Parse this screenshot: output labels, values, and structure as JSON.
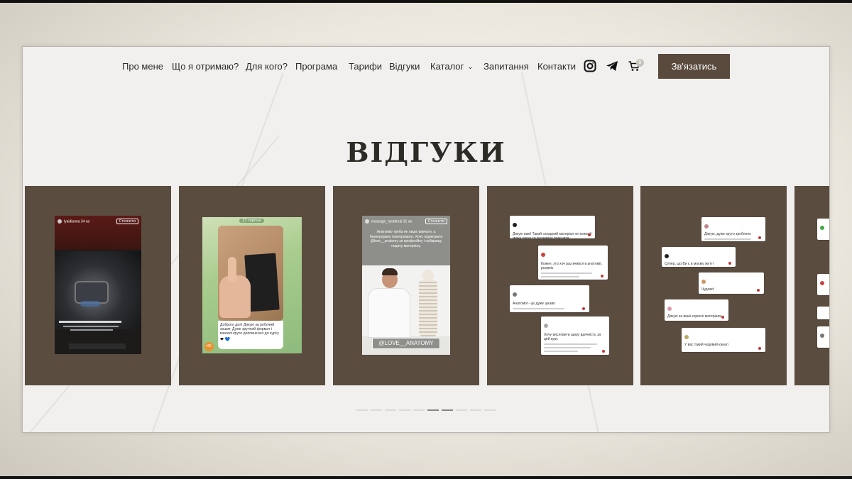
{
  "nav": {
    "items": [
      "Про мене",
      "Що я отримаю?",
      "Для кого?",
      "Програма",
      "Тарифи",
      "Відгуки",
      "Каталог",
      "Запитання",
      "Контакти"
    ],
    "cart_count": "0",
    "cta_label": "Зв'язатись"
  },
  "section_title": "ВІДГУКИ",
  "cards": [
    {
      "type": "story",
      "username": "lyaidianna",
      "time": "34 хв",
      "button": "Стежити"
    },
    {
      "type": "chat",
      "date": "23 серпня",
      "message": "Доброго дня! Дякую за робочий зошит. Дуже зручний формат і взагалі круте доповнення до курсу",
      "avatar_label": "КК"
    },
    {
      "type": "story",
      "username": "massage_nyuttireal",
      "time": "31 хв",
      "button": "Стежити",
      "caption": "Анатомію треба не лише вивчати, а безперервно повторювати. Хочу подякувати @love__anatomy за професійну і найкращу подачу матеріалу.",
      "tag": "@LOVE__ANATOMY"
    },
    {
      "type": "comments",
      "comments": [
        {
          "text": "Дякую вам! Такий складний матеріал не кожний може легко та зрозуміло пояснити"
        },
        {
          "text": "Кожен, хто хоч раз вчився в анатомії, розуміє"
        },
        {
          "text": "Анатомія - це дуже цікаво"
        },
        {
          "text": "Хочу висловити щиру вдячність за цей курс"
        }
      ]
    },
    {
      "type": "comments",
      "comments": [
        {
          "text": "Дякую, дуже круто зроблено"
        },
        {
          "text": "Супер, що Ви є в моєму житті"
        },
        {
          "text": "Чудово!"
        },
        {
          "text": "Дякую за ваші корисні матеріали"
        },
        {
          "text": "У вас такий чудовий канал"
        }
      ]
    }
  ],
  "pagination": {
    "total": 10,
    "active": [
      5,
      6
    ]
  },
  "colors": {
    "card": "#5b4c40",
    "cta": "#5a4a3d",
    "background": "#f1f0ee"
  }
}
